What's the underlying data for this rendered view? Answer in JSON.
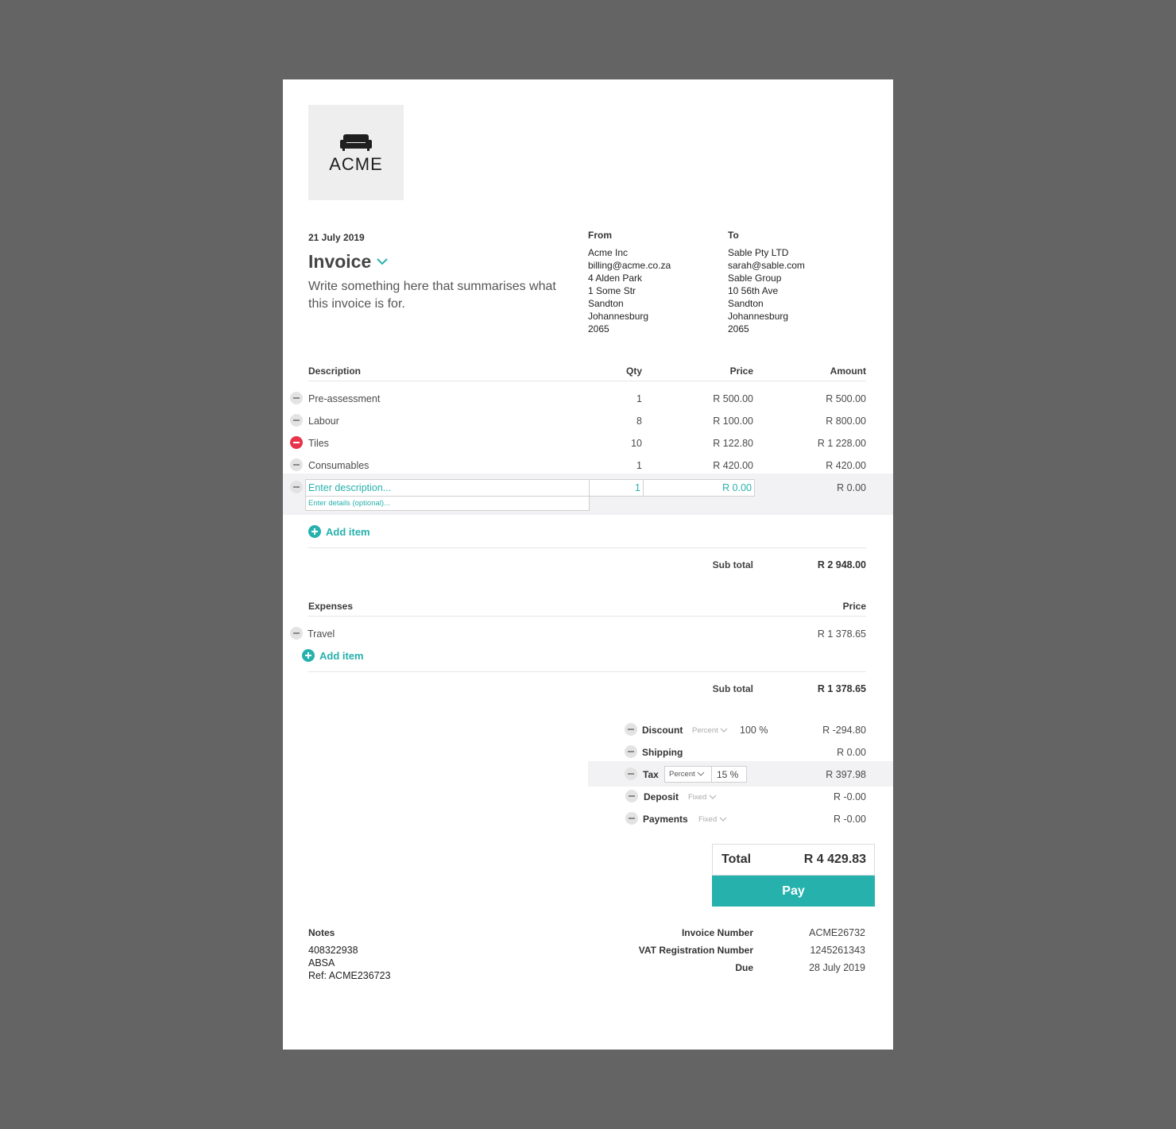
{
  "logo": {
    "text": "ACME",
    "icon": "sofa-icon"
  },
  "header": {
    "date": "21 July 2019",
    "title": "Invoice",
    "summary": "Write something here that summarises what this invoice is for."
  },
  "from": {
    "heading": "From",
    "lines": [
      "Acme Inc",
      "billing@acme.co.za",
      "4 Alden Park",
      "1 Some Str",
      "Sandton",
      "Johannesburg",
      "2065"
    ]
  },
  "to": {
    "heading": "To",
    "lines": [
      "Sable Pty LTD",
      "sarah@sable.com",
      "Sable Group",
      "10 56th Ave",
      "Sandton",
      "Johannesburg",
      "2065"
    ]
  },
  "items": {
    "headers": {
      "description": "Description",
      "qty": "Qty",
      "price": "Price",
      "amount": "Amount"
    },
    "rows": [
      {
        "description": "Pre-assessment",
        "qty": "1",
        "price": "R 500.00",
        "amount": "R 500.00"
      },
      {
        "description": "Labour",
        "qty": "8",
        "price": "R 100.00",
        "amount": "R 800.00"
      },
      {
        "description": "Tiles",
        "qty": "10",
        "price": "R 122.80",
        "amount": "R 1 228.00"
      },
      {
        "description": "Consumables",
        "qty": "1",
        "price": "R 420.00",
        "amount": "R 420.00"
      }
    ],
    "new_row": {
      "description_placeholder": "Enter description...",
      "details_placeholder": "Enter details (optional)...",
      "qty": "1",
      "price": "R 0.00",
      "amount": "R 0.00"
    },
    "add_label": "Add item",
    "subtotal_label": "Sub total",
    "subtotal_value": "R 2 948.00"
  },
  "expenses": {
    "headers": {
      "description": "Expenses",
      "price": "Price"
    },
    "rows": [
      {
        "description": "Travel",
        "price": "R 1 378.65"
      }
    ],
    "add_label": "Add item",
    "subtotal_label": "Sub total",
    "subtotal_value": "R 1 378.65"
  },
  "adjustments": {
    "discount": {
      "label": "Discount",
      "type": "Percent",
      "rate": "100 %",
      "value": "R -294.80"
    },
    "shipping": {
      "label": "Shipping",
      "value": "R 0.00"
    },
    "tax": {
      "label": "Tax",
      "type": "Percent",
      "rate": "15 %",
      "value": "R 397.98"
    },
    "deposit": {
      "label": "Deposit",
      "type": "Fixed",
      "value": "R -0.00"
    },
    "payments": {
      "label": "Payments",
      "type": "Fixed",
      "value": "R -0.00"
    }
  },
  "total": {
    "label": "Total",
    "value": "R 4 429.83",
    "pay_label": "Pay"
  },
  "notes": {
    "heading": "Notes",
    "lines": [
      "408322938",
      "ABSA",
      "Ref: ACME236723"
    ]
  },
  "meta": {
    "invoice_number_label": "Invoice Number",
    "invoice_number": "ACME26732",
    "vat_label": "VAT Registration Number",
    "vat": "1245261343",
    "due_label": "Due",
    "due": "28 July 2019"
  },
  "colors": {
    "accent": "#26b1ad",
    "danger": "#e8344a",
    "background": "#646464"
  }
}
